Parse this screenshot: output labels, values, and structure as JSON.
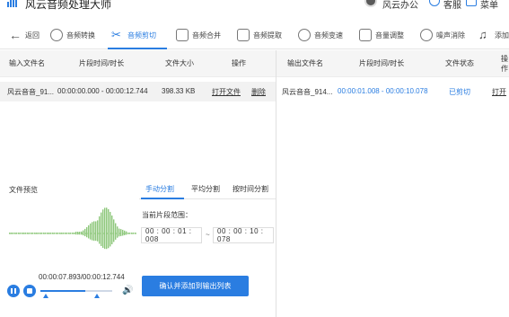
{
  "app": {
    "title": "风云音频处理大师",
    "user_name": "风云办公",
    "service_label": "客服",
    "menu_label": "菜单"
  },
  "toolbar": {
    "back_label": "返回",
    "tools": [
      {
        "label": "音频转换"
      },
      {
        "label": "音频剪切"
      },
      {
        "label": "音频合并"
      },
      {
        "label": "音频提取"
      },
      {
        "label": "音频变速"
      },
      {
        "label": "音量调整"
      },
      {
        "label": "噪声消除"
      },
      {
        "label": "添加"
      }
    ]
  },
  "input_table": {
    "headers": [
      "输入文件名",
      "片段时间/时长",
      "文件大小",
      "操作"
    ],
    "rows": [
      {
        "name": "风云音音_91...",
        "duration": "00:00:00.000 - 00:00:12.744",
        "size": "398.33 KB",
        "open": "打开文件",
        "delete": "删除"
      }
    ]
  },
  "output_table": {
    "headers": [
      "输出文件名",
      "片段时间/时长",
      "文件状态",
      "操作"
    ],
    "rows": [
      {
        "name": "风云音音_914...",
        "duration": "00:00:01.008 - 00:00:10.078",
        "status": "已剪切",
        "open": "打开"
      }
    ]
  },
  "preview": {
    "label": "文件预览",
    "time_display": "00:00:07.893/00:00:12.744",
    "progress": 0.619,
    "marker_start": 0.079,
    "marker_end": 0.791
  },
  "split": {
    "tabs": [
      "手动分割",
      "平均分割",
      "按时间分割"
    ],
    "range_label": "当前片段范围：",
    "start_time": "00 : 00 : 01 : 008",
    "end_time": "00 : 00 : 10 : 078",
    "separator": "~",
    "confirm_label": "确认并添加到输出列表"
  },
  "colors": {
    "accent": "#2a7de1",
    "wave": "#8dc77a"
  }
}
